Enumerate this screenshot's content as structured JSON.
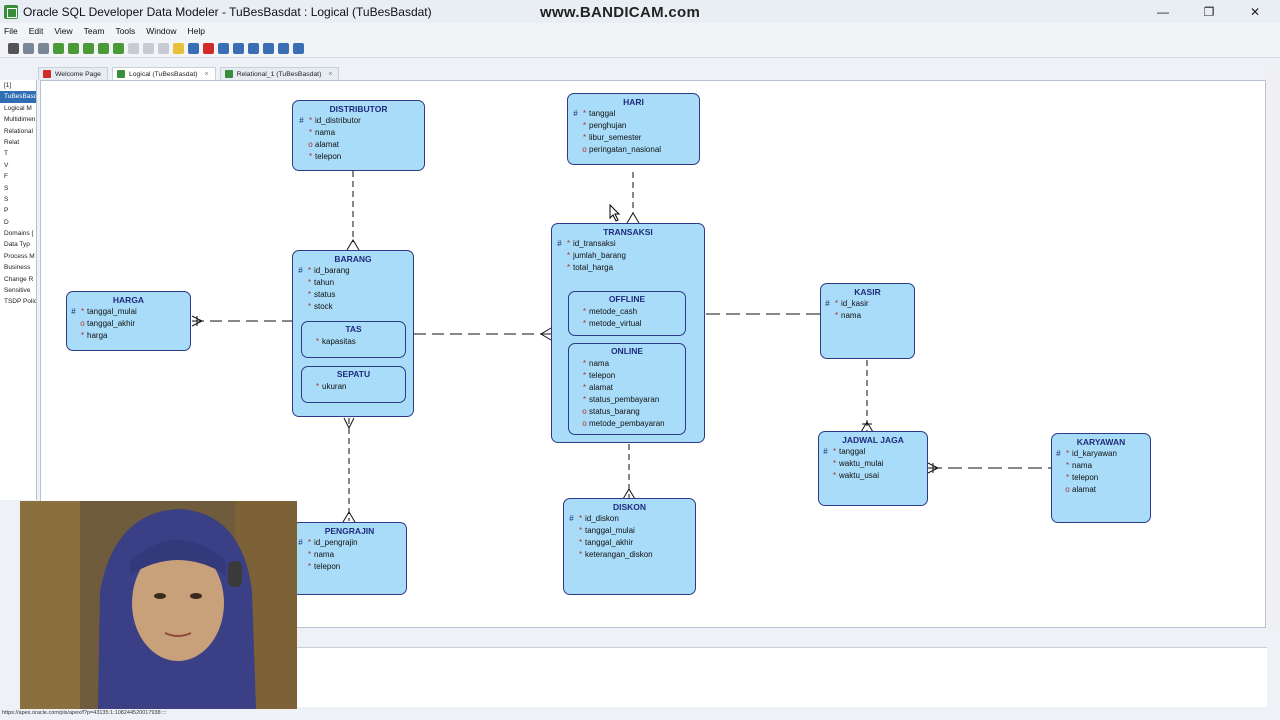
{
  "window": {
    "title": "Oracle SQL Developer Data Modeler - TuBesBasdat : Logical (TuBesBasdat)",
    "watermark": "www.BANDICAM.com",
    "minimize": "—",
    "restore": "❐",
    "close": "✕"
  },
  "menu": [
    "File",
    "Edit",
    "View",
    "Team",
    "Tools",
    "Window",
    "Help"
  ],
  "tabs": [
    {
      "label": "Welcome Page",
      "close": ""
    },
    {
      "label": "Logical (TuBesBasdat)",
      "close": "×"
    },
    {
      "label": "Relational_1 (TuBesBasdat)",
      "close": "×"
    }
  ],
  "nav": [
    "[1]",
    "TuBesBasdat",
    "Logical M",
    "Multidimen",
    "Relational",
    "Relat",
    "T",
    "V",
    "F",
    "S",
    "S",
    "P",
    "D",
    "Domains [",
    "Data Typ",
    "Process M",
    "Business",
    "Change R",
    "Sensitive",
    "TSDP Polic"
  ],
  "entities": {
    "distributor": {
      "name": "DISTRIBUTOR",
      "attrs": [
        [
          "#",
          "*",
          "id_distributor"
        ],
        [
          "",
          "*",
          "nama"
        ],
        [
          "",
          "o",
          "alamat"
        ],
        [
          "",
          "*",
          "telepon"
        ]
      ]
    },
    "hari": {
      "name": "HARI",
      "attrs": [
        [
          "#",
          "*",
          "tanggal"
        ],
        [
          "",
          "*",
          "penghujan"
        ],
        [
          "",
          "*",
          "libur_semester"
        ],
        [
          "",
          "o",
          "peringatan_nasional"
        ]
      ]
    },
    "transaksi": {
      "name": "TRANSAKSI",
      "attrs": [
        [
          "#",
          "*",
          "id_transaksi"
        ],
        [
          "",
          "*",
          "jumlah_barang"
        ],
        [
          "",
          "*",
          "total_harga"
        ]
      ]
    },
    "offline": {
      "name": "OFFLINE",
      "attrs": [
        [
          "",
          "*",
          "metode_cash"
        ],
        [
          "",
          "*",
          "metode_virtual"
        ]
      ]
    },
    "online": {
      "name": "ONLINE",
      "attrs": [
        [
          "",
          "*",
          "nama"
        ],
        [
          "",
          "*",
          "telepon"
        ],
        [
          "",
          "*",
          "alamat"
        ],
        [
          "",
          "*",
          "status_pembayaran"
        ],
        [
          "",
          "o",
          "status_barang"
        ],
        [
          "",
          "o",
          "metode_pembayaran"
        ]
      ]
    },
    "barang": {
      "name": "BARANG",
      "attrs": [
        [
          "#",
          "*",
          "id_barang"
        ],
        [
          "",
          "*",
          "tahun"
        ],
        [
          "",
          "*",
          "status"
        ],
        [
          "",
          "*",
          "stock"
        ]
      ]
    },
    "tas": {
      "name": "TAS",
      "attrs": [
        [
          "",
          "*",
          "kapasitas"
        ]
      ]
    },
    "sepatu": {
      "name": "SEPATU",
      "attrs": [
        [
          "",
          "*",
          "ukuran"
        ]
      ]
    },
    "harga": {
      "name": "HARGA",
      "attrs": [
        [
          "#",
          "*",
          "tanggal_mulai"
        ],
        [
          "",
          "o",
          "tanggal_akhir"
        ],
        [
          "",
          "*",
          "harga"
        ]
      ]
    },
    "kasir": {
      "name": "KASIR",
      "attrs": [
        [
          "#",
          "*",
          "id_kasir"
        ],
        [
          "",
          "*",
          "nama"
        ]
      ]
    },
    "jadwal_jaga": {
      "name": "JADWAL JAGA",
      "attrs": [
        [
          "#",
          "*",
          "tanggal"
        ],
        [
          "",
          "*",
          "waktu_mulai"
        ],
        [
          "",
          "*",
          "waktu_usai"
        ]
      ]
    },
    "karyawan": {
      "name": "KARYAWAN",
      "attrs": [
        [
          "#",
          "*",
          "id_karyawan"
        ],
        [
          "",
          "*",
          "nama"
        ],
        [
          "",
          "*",
          "telepon"
        ],
        [
          "",
          "o",
          "alamat"
        ]
      ]
    },
    "pengrajin": {
      "name": "PENGRAJIN",
      "attrs": [
        [
          "#",
          "*",
          "id_pengrajin"
        ],
        [
          "",
          "*",
          "nama"
        ],
        [
          "",
          "*",
          "telepon"
        ]
      ]
    },
    "diskon": {
      "name": "DISKON",
      "attrs": [
        [
          "#",
          "*",
          "id_diskon"
        ],
        [
          "",
          "*",
          "tanggal_mulai"
        ],
        [
          "",
          "*",
          "tanggal_akhir"
        ],
        [
          "",
          "*",
          "keterangan_diskon"
        ]
      ]
    }
  },
  "status_url": "https://apex.oracle.com/pls/apex/f?p=43135:1:108244520017938::::",
  "colors": {
    "entity_fill": "#a9dcf8",
    "entity_border": "#2d3a86",
    "entity_title": "#1f2c7c",
    "nav_selected": "#2f6db5"
  }
}
